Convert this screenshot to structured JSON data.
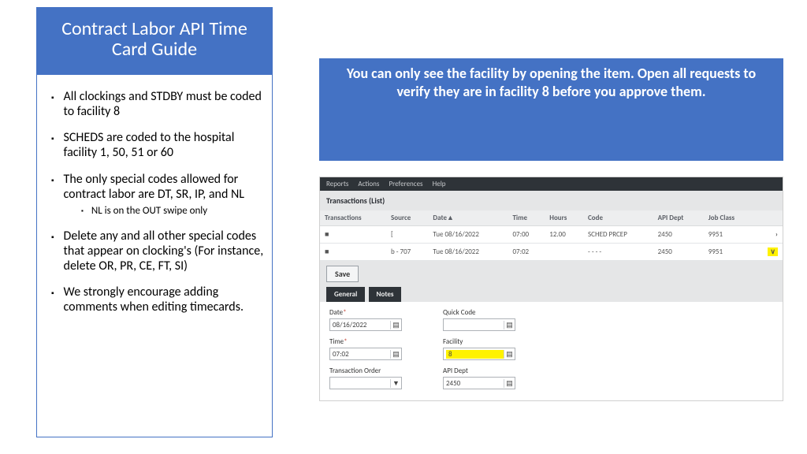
{
  "left": {
    "title": "Contract Labor API Time Card Guide",
    "b1": "All clockings and STDBY must be coded to facility 8",
    "b2": "SCHEDS are coded to the hospital facility 1, 50, 51 or 60",
    "b3": "The only special codes allowed for contract labor are DT, SR, IP, and NL",
    "s1": "NL is on the OUT swipe only",
    "b4": "Delete any and all other special codes that appear on clocking's (For instance, delete OR, PR, CE, FT, SI)",
    "b5": "We strongly encourage adding comments when editing timecards."
  },
  "right_note": "You can only see the facility by opening the item.  Open all requests to verify they are in facility 8 before you approve them.",
  "menu": {
    "m1": "Reports",
    "m2": "Actions",
    "m3": "Preferences",
    "m4": "Help"
  },
  "list": {
    "title": "Transactions (List)",
    "h": {
      "c1": "Transactions",
      "c2": "Source",
      "c3": "Date",
      "c4": "Time",
      "c5": "Hours",
      "c6": "Code",
      "c7": "API Dept",
      "c8": "Job Class"
    },
    "row1": {
      "source": "[",
      "date": "Tue 08/16/2022",
      "time": "07:00",
      "hours": "12.00",
      "code": "SCHED PRCEP",
      "dept": "2450",
      "job": "9951"
    },
    "row2": {
      "source": "b - 707",
      "date": "Tue 08/16/2022",
      "time": "07:02",
      "hours": "",
      "code": "- - - -",
      "dept": "2450",
      "job": "9951"
    }
  },
  "save": "Save",
  "tabs": {
    "t1": "General",
    "t2": "Notes"
  },
  "form": {
    "date_label": "Date",
    "date_val": "08/16/2022",
    "qc_label": "Quick Code",
    "qc_val": "",
    "time_label": "Time",
    "time_val": "07:02",
    "fac_label": "Facility",
    "fac_val": "8",
    "to_label": "Transaction Order",
    "to_val": "",
    "dept_label": "API Dept",
    "dept_val": "2450"
  }
}
